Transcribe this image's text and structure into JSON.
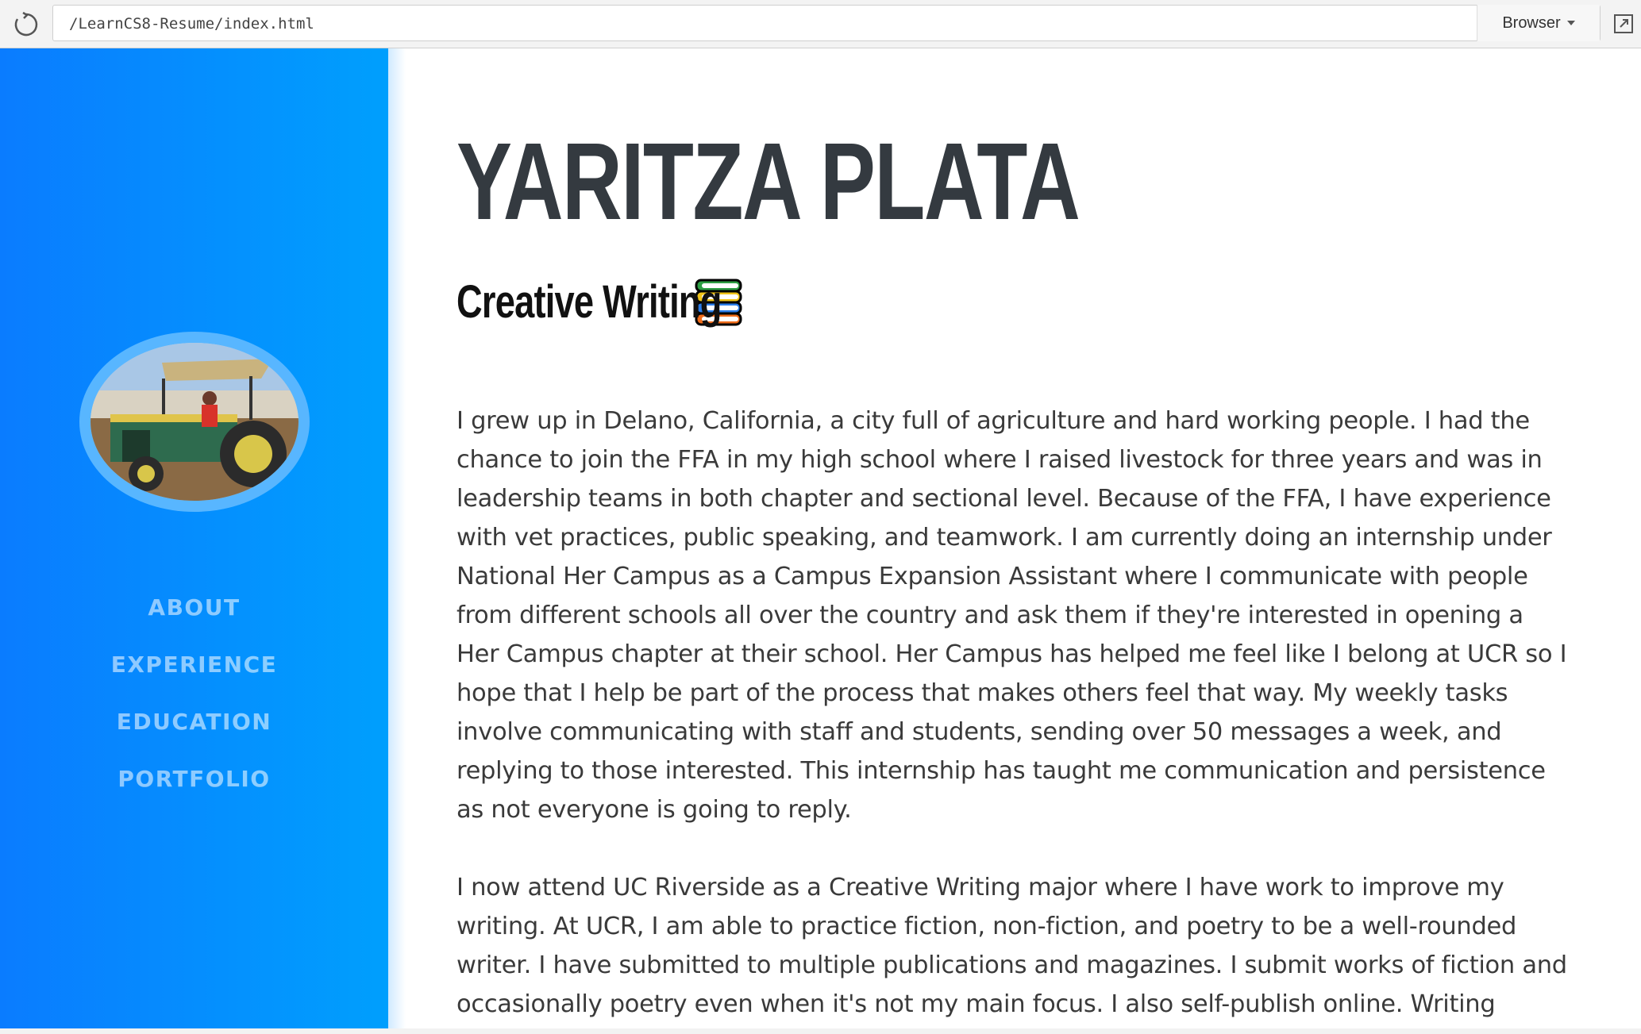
{
  "browser": {
    "url": "/LearnCS8-Resume/index.html",
    "mode_label": "Browser"
  },
  "sidebar": {
    "gradient": [
      "#0a7cff",
      "#009ffd"
    ],
    "nav": [
      {
        "label": "ABOUT"
      },
      {
        "label": "EXPERIENCE"
      },
      {
        "label": "EDUCATION"
      },
      {
        "label": "PORTFOLIO"
      }
    ]
  },
  "profile": {
    "name": "YARITZA PLATA",
    "subtitle": "Creative Writing",
    "subtitle_icon": "books-icon",
    "paragraphs": [
      "I grew up in Delano, California, a city full of agriculture and hard working people. I had the chance to join the FFA in my high school where I raised livestock for three years and was in leadership teams in both chapter and sectional level. Because of the FFA, I have experience with vet practices, public speaking, and teamwork. I am currently doing an internship under National Her Campus as a Campus Expansion Assistant where I communicate with people from different schools all over the country and ask them if they're interested in opening a Her Campus chapter at their school. Her Campus has helped me feel like I belong at UCR so I hope that I help be part of the process that makes others feel that way. My weekly tasks involve communicating with staff and students, sending over 50 messages a week, and replying to those interested. This internship has taught me communication and persistence as not everyone is going to reply.",
      "I now attend UC Riverside as a Creative Writing major where I have work to improve my writing. At UCR, I am able to practice fiction, non-fiction, and poetry to be a well-rounded writer. I have submitted to multiple publications and magazines. I submit works of fiction and occasionally poetry even when it's not my main focus. I also self-publish online. Writing"
    ]
  },
  "colors": {
    "heading": "#343a40",
    "body_text": "#3a3a3a",
    "nav_text": "rgba(255,255,255,0.55)"
  }
}
